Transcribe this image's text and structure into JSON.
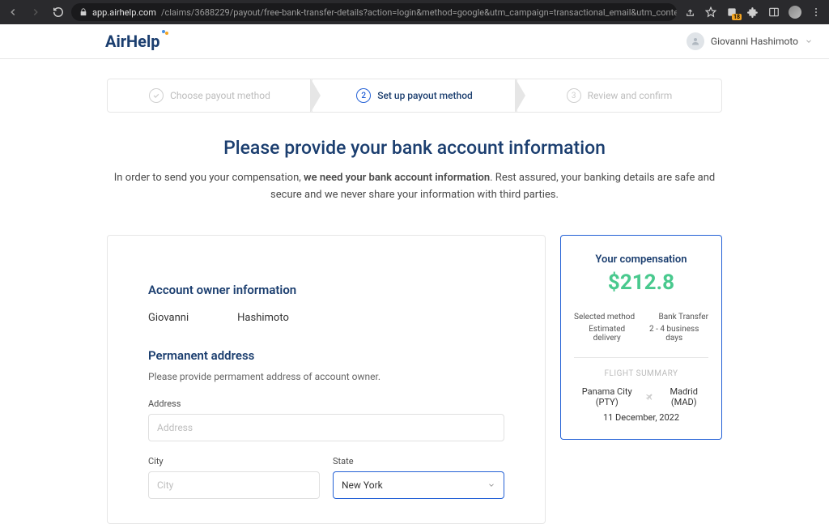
{
  "browser": {
    "url_host": "app.airhelp.com",
    "url_path": "/claims/3688229/payout/free-bank-transfer-details?action=login&method=google&utm_campaign=transactional_email&utm_content...",
    "ext_badge": "18"
  },
  "header": {
    "logo": "AirHelp",
    "user_name": "Giovanni Hashimoto"
  },
  "stepper": {
    "step1": "Choose payout method",
    "step2_num": "2",
    "step2": "Set up payout method",
    "step3_num": "3",
    "step3": "Review and confirm"
  },
  "title": "Please provide your bank account information",
  "desc_pre": "In order to send you your compensation, ",
  "desc_bold": "we need your bank account information",
  "desc_post": ". Rest assured, your banking details are safe and secure and we never share your information with third parties.",
  "form": {
    "account_owner_title": "Account owner information",
    "first_name": "Giovanni",
    "last_name": "Hashimoto",
    "perm_addr_title": "Permanent address",
    "perm_addr_hint": "Please provide permament address of account owner.",
    "address_label": "Address",
    "address_placeholder": "Address",
    "city_label": "City",
    "city_placeholder": "City",
    "state_label": "State",
    "state_value": "New York"
  },
  "compensation": {
    "title": "Your compensation",
    "amount": "$212.8",
    "selected_method_label": "Selected method",
    "selected_method_value": "Bank Transfer",
    "delivery_label": "Estimated delivery",
    "delivery_value": "2 - 4 business days",
    "flight_summary_label": "FLIGHT SUMMARY",
    "origin": "Panama City (PTY)",
    "destination": "Madrid (MAD)",
    "date": "11 December, 2022"
  }
}
